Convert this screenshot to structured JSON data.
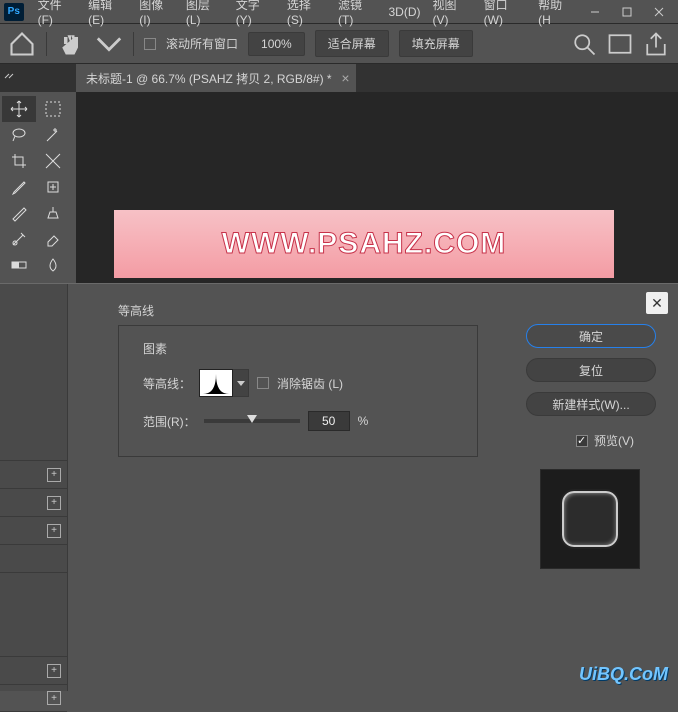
{
  "menu": {
    "file": "文件(F)",
    "edit": "编辑(E)",
    "image": "图像(I)",
    "layer": "图层(L)",
    "type": "文字(Y)",
    "select": "选择(S)",
    "filter": "滤镜(T)",
    "threeD": "3D(D)",
    "view": "视图(V)",
    "window": "窗口(W)",
    "help": "帮助(H"
  },
  "toolbar": {
    "scrollAll": "滚动所有窗口",
    "zoom": "100%",
    "fitScreen": "适合屏幕",
    "fillScreen": "填充屏幕"
  },
  "docTab": {
    "title": "未标题-1 @ 66.7% (PSAHZ 拷贝 2, RGB/8#) *"
  },
  "banner": {
    "text": "WWW.PSAHZ.COM"
  },
  "dialog": {
    "sectionTitle": "等高线",
    "groupTitle": "图素",
    "contourLabel": "等高线：",
    "antialias": "消除锯齿 (L)",
    "rangeLabel": "范围(R)：",
    "rangeValue": "50",
    "pct": "%",
    "ok": "确定",
    "reset": "复位",
    "newStyle": "新建样式(W)...",
    "preview": "预览(V)"
  },
  "watermark": "UiBQ.CoM"
}
